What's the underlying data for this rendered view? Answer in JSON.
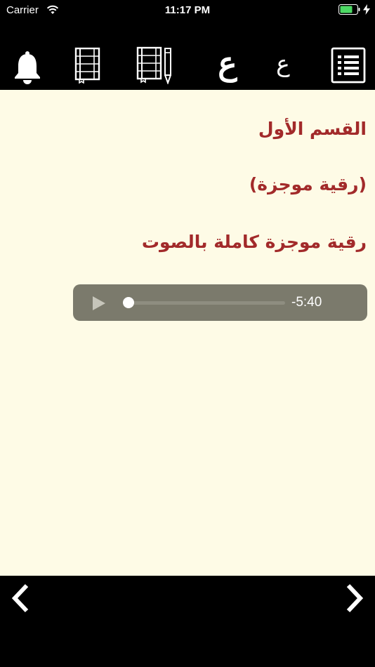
{
  "status_bar": {
    "carrier": "Carrier",
    "time": "11:17 PM"
  },
  "toolbar": {
    "icons": [
      "bell-icon",
      "notebook-icon",
      "notebook-pencil-icon",
      "font-large-icon",
      "font-small-icon",
      "list-icon"
    ],
    "font_large_label": "ع",
    "font_small_label": "ع"
  },
  "content": {
    "heading_1": "القسم الأول",
    "heading_2": "(رقية موجزة)",
    "heading_3": "رقية موجزة كاملة بالصوت",
    "text_color": "#a22a2a",
    "background": "#fefbe6"
  },
  "audio_player": {
    "remaining_time": "-5:40",
    "progress": 0
  },
  "bottom_bar": {
    "icons": [
      "chevron-left-icon",
      "chevron-right-icon"
    ]
  }
}
